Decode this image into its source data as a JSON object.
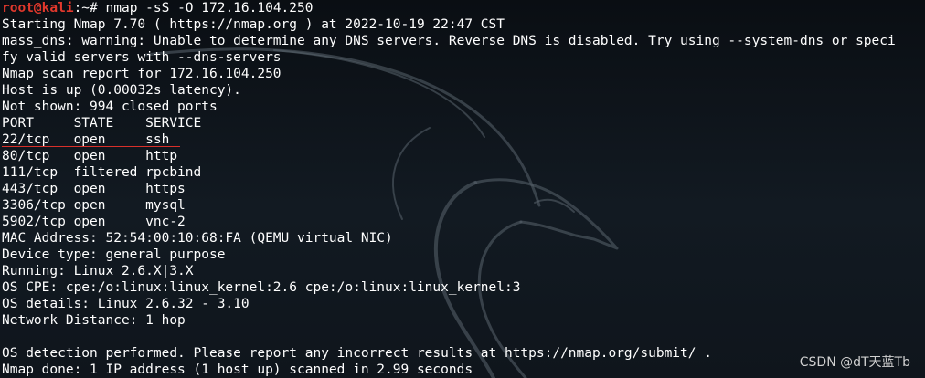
{
  "terminal": {
    "prompt": {
      "user_host": "root@kali",
      "path_symbol": ":~# ",
      "command": "nmap -sS -O 172.16.104.250"
    },
    "output": [
      "Starting Nmap 7.70 ( https://nmap.org ) at 2022-10-19 22:47 CST",
      "mass_dns: warning: Unable to determine any DNS servers. Reverse DNS is disabled. Try using --system-dns or speci",
      "fy valid servers with --dns-servers",
      "Nmap scan report for 172.16.104.250",
      "Host is up (0.00032s latency).",
      "Not shown: 994 closed ports",
      "PORT     STATE    SERVICE",
      "22/tcp   open     ssh",
      "80/tcp   open     http",
      "111/tcp  filtered rpcbind",
      "443/tcp  open     https",
      "3306/tcp open     mysql",
      "5902/tcp open     vnc-2",
      "MAC Address: 52:54:00:10:68:FA (QEMU virtual NIC)",
      "Device type: general purpose",
      "Running: Linux 2.6.X|3.X",
      "OS CPE: cpe:/o:linux:linux_kernel:2.6 cpe:/o:linux:linux_kernel:3",
      "OS details: Linux 2.6.32 - 3.10",
      "Network Distance: 1 hop",
      "",
      "OS detection performed. Please report any incorrect results at https://nmap.org/submit/ .",
      "Nmap done: 1 IP address (1 host up) scanned in 2.99 seconds"
    ]
  },
  "watermark": "CSDN @dT天蓝Tb",
  "colors": {
    "prompt_user": "#e2382c",
    "underline": "#d9302a",
    "background": "#0f151c",
    "text": "#ffffff"
  },
  "icons": {
    "background_logo": "kali-dragon-icon"
  }
}
